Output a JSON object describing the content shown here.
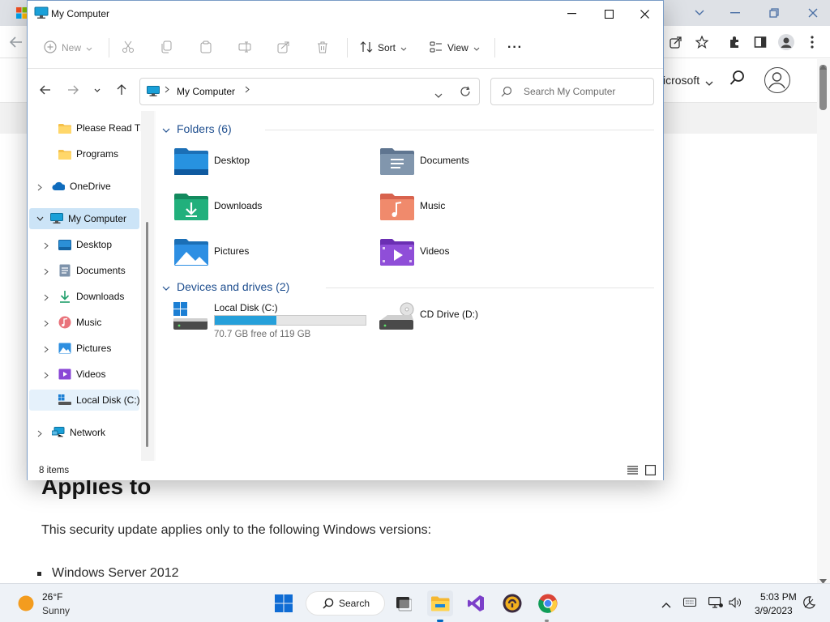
{
  "browser": {
    "header_text": "icrosoft",
    "article_heading": "Applies to",
    "article_paragraph": "This security update applies only to the following Windows versions:",
    "article_list": [
      "Windows Server 2012"
    ]
  },
  "explorer": {
    "title": "My Computer",
    "toolbar": {
      "new_label": "New",
      "sort_label": "Sort",
      "view_label": "View",
      "more_label": "···"
    },
    "address": {
      "crumb": "My Computer"
    },
    "search": {
      "placeholder": "Search My Computer"
    },
    "nav": {
      "items": [
        {
          "label": "Please Read This",
          "icon": "folder-icon"
        },
        {
          "label": "Programs",
          "icon": "folder-icon"
        },
        {
          "label": "OneDrive",
          "icon": "cloud-icon"
        },
        {
          "label": "My Computer",
          "icon": "computer-icon"
        },
        {
          "label": "Desktop",
          "icon": "desktop-icon"
        },
        {
          "label": "Documents",
          "icon": "documents-icon"
        },
        {
          "label": "Downloads",
          "icon": "download-icon"
        },
        {
          "label": "Music",
          "icon": "music-icon"
        },
        {
          "label": "Pictures",
          "icon": "pictures-icon"
        },
        {
          "label": "Videos",
          "icon": "videos-icon"
        },
        {
          "label": "Local Disk (C:)",
          "icon": "drive-icon"
        },
        {
          "label": "Network",
          "icon": "network-icon"
        }
      ]
    },
    "folders_header": "Folders (6)",
    "folders": [
      {
        "label": "Desktop",
        "icon": "desktop-folder-icon"
      },
      {
        "label": "Documents",
        "icon": "documents-folder-icon"
      },
      {
        "label": "Downloads",
        "icon": "downloads-folder-icon"
      },
      {
        "label": "Music",
        "icon": "music-folder-icon"
      },
      {
        "label": "Pictures",
        "icon": "pictures-folder-icon"
      },
      {
        "label": "Videos",
        "icon": "videos-folder-icon"
      }
    ],
    "drives_header": "Devices and drives (2)",
    "drives": [
      {
        "label": "Local Disk (C:)",
        "free_text": "70.7 GB free of 119 GB",
        "used_fraction": 0.406
      },
      {
        "label": "CD Drive (D:)"
      }
    ],
    "status": {
      "count": "8 items"
    }
  },
  "taskbar": {
    "weather_temp": "26°F",
    "weather_desc": "Sunny",
    "search_label": "Search",
    "time": "5:03 PM",
    "date": "3/9/2023"
  },
  "colors": {
    "accent": "#0067c0",
    "selection": "#cce4f7",
    "drive_bar": "#26a0da",
    "group_header": "#1f4f8f"
  }
}
